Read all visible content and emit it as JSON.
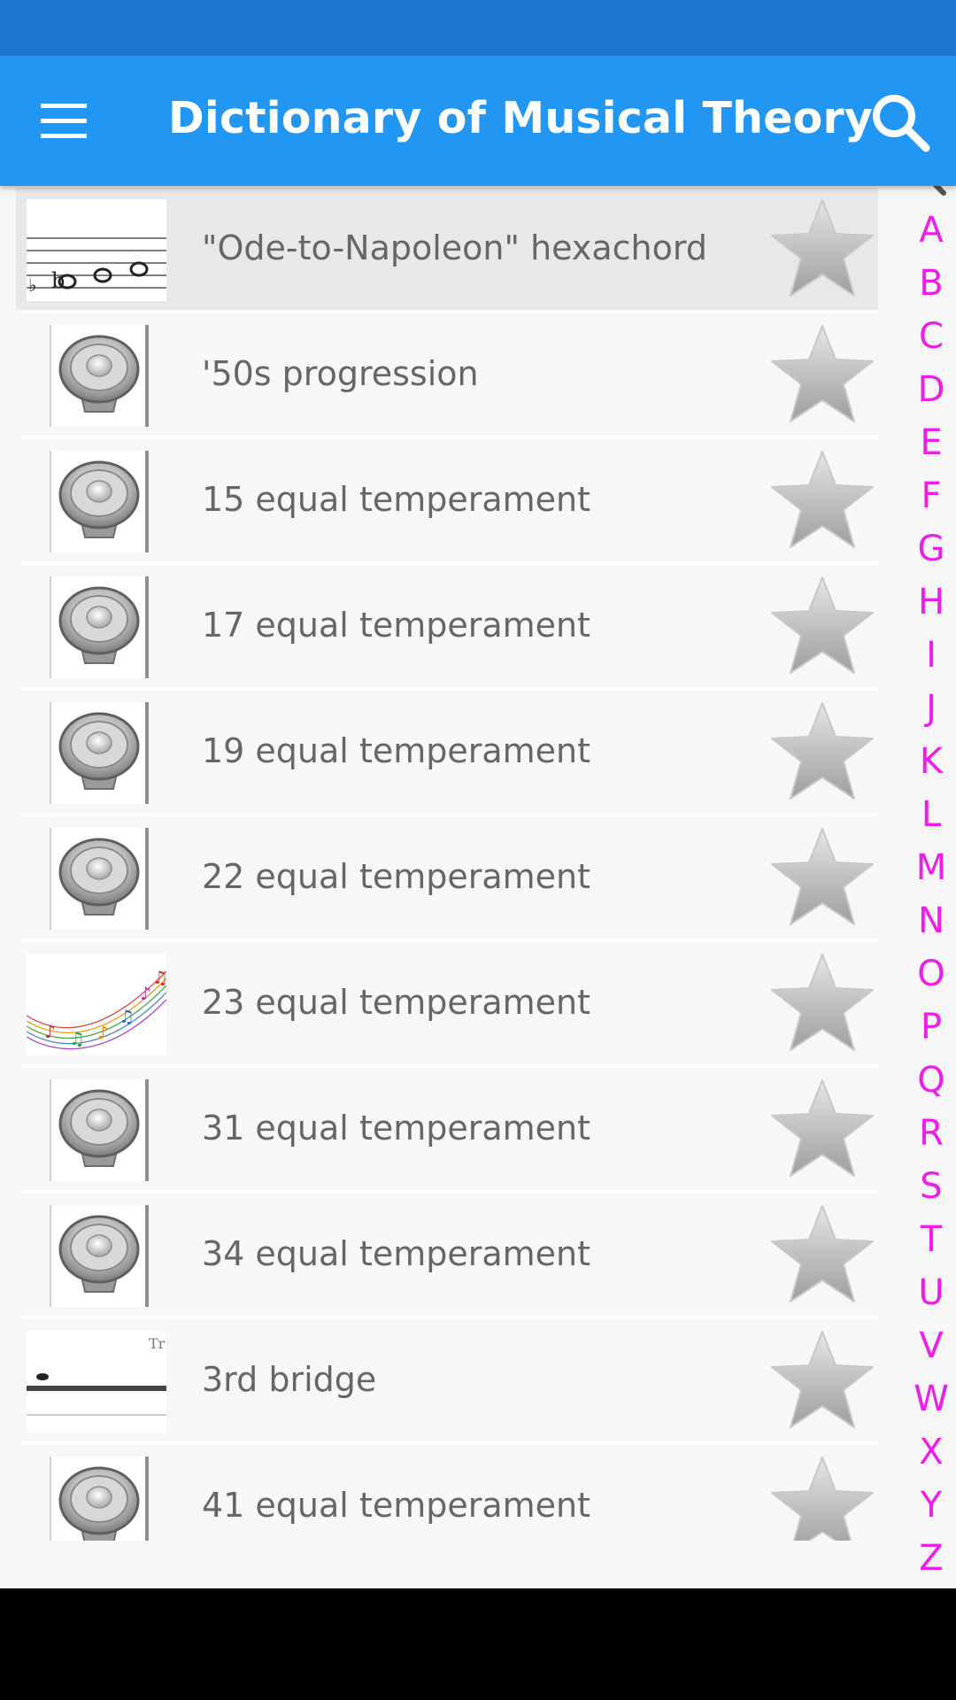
{
  "app_bar": {
    "title": "Dictionary of Musical Theory",
    "menu_icon": "hamburger-menu-icon",
    "search_icon": "search-icon"
  },
  "entries": [
    {
      "label": "\"Ode-to-Napoleon\" hexachord",
      "thumb": "sheet-music-image",
      "selected": true
    },
    {
      "label": "'50s progression",
      "thumb": "speaker-icon"
    },
    {
      "label": "15 equal temperament",
      "thumb": "speaker-icon"
    },
    {
      "label": "17 equal temperament",
      "thumb": "speaker-icon"
    },
    {
      "label": "19 equal temperament",
      "thumb": "speaker-icon"
    },
    {
      "label": "22 equal temperament",
      "thumb": "speaker-icon"
    },
    {
      "label": "23 equal temperament",
      "thumb": "colorful-notes-image"
    },
    {
      "label": "31 equal temperament",
      "thumb": "speaker-icon"
    },
    {
      "label": "34 equal temperament",
      "thumb": "speaker-icon"
    },
    {
      "label": "3rd bridge",
      "thumb": "staff-line-image"
    },
    {
      "label": "41 equal temperament",
      "thumb": "speaker-icon"
    }
  ],
  "index_bar": {
    "search_icon": "index-search-icon",
    "letters": [
      "A",
      "B",
      "C",
      "D",
      "E",
      "F",
      "G",
      "H",
      "I",
      "J",
      "K",
      "L",
      "M",
      "N",
      "O",
      "P",
      "Q",
      "R",
      "S",
      "T",
      "U",
      "V",
      "W",
      "X",
      "Y",
      "Z"
    ],
    "color": "#ee1ee8"
  },
  "colors": {
    "status_bar": "#1f78d0",
    "app_bar": "#2196f3",
    "list_background": "#f7f7f7",
    "selected_row": "#e8e8e8",
    "label_text": "#666666"
  }
}
